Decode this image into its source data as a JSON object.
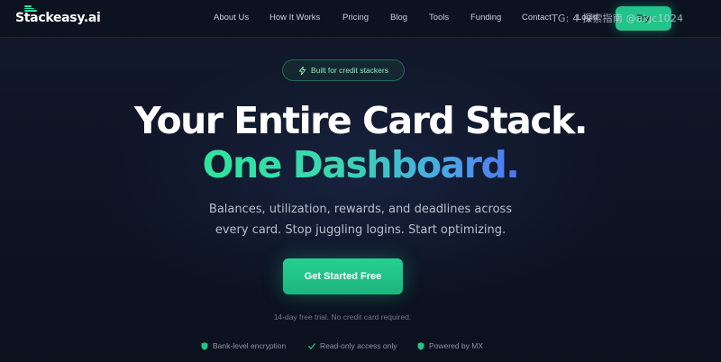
{
  "nav": {
    "logo": "Stackeasy.ai",
    "links": [
      "About Us",
      "How It Works",
      "Pricing",
      "Blog",
      "Tools",
      "Funding",
      "Contact",
      "Login"
    ],
    "cta_label": "Try"
  },
  "watermark": "TG: 4 探索指南 @aigc1024",
  "hero": {
    "badge": "Built for credit stackers",
    "headline_line1": "Your Entire Card Stack.",
    "headline_line2": "One Dashboard",
    "headline_line2_dot": ".",
    "subtitle_line1": "Balances, utilization, rewards, and deadlines across",
    "subtitle_line2": "every card. Stop juggling logins. Start optimizing.",
    "cta_label": "Get Started Free",
    "note": "14-day free trial. No credit card required."
  },
  "trust": [
    {
      "label": "Bank-level encryption",
      "icon": "shield-icon"
    },
    {
      "label": "Read-only access only",
      "icon": "check-icon"
    },
    {
      "label": "Powered by MX",
      "icon": "shield-icon"
    }
  ],
  "colors": {
    "accent": "#22c48a",
    "blue": "#4f78f2",
    "background": "#0d1220"
  }
}
